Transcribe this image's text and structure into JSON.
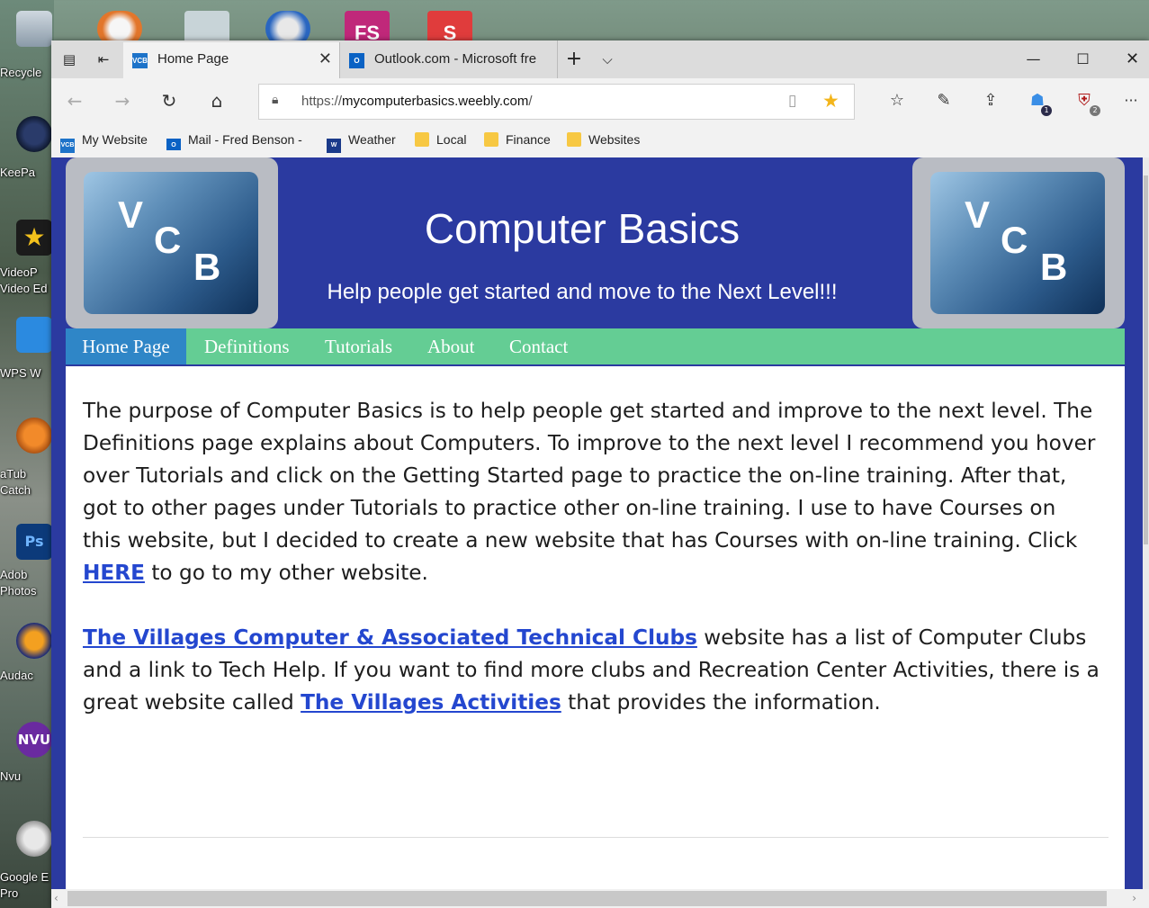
{
  "desktop": {
    "icons": [
      {
        "label": "Recycle"
      },
      {
        "label": "KeePa"
      },
      {
        "label": "VideoP\nVideo Ed"
      },
      {
        "label": "WPS W"
      },
      {
        "label": "aTub\nCatch"
      },
      {
        "label": "Adob\nPhotos"
      },
      {
        "label": "Audac"
      },
      {
        "label": "Nvu"
      },
      {
        "label": "Google E\nPro"
      }
    ],
    "top_apps": [
      {
        "text": ""
      },
      {
        "text": ""
      },
      {
        "text": ""
      },
      {
        "text": "FS"
      },
      {
        "text": "S"
      }
    ]
  },
  "browser": {
    "tabs": [
      {
        "title": "Home Page",
        "favicon": "VCB",
        "active": true
      },
      {
        "title": "Outlook.com - Microsoft fre",
        "favicon": "O",
        "active": false
      }
    ],
    "new_tab": "+",
    "tab_list": "⌵",
    "window_controls": {
      "minimize": "—",
      "maximize": "☐",
      "close": "✕"
    },
    "address": {
      "scheme": "https://",
      "host": "mycomputerbasics.weebly.com",
      "path": "/"
    },
    "extensions": [
      {
        "name": "ghostery-icon",
        "badge": "1"
      },
      {
        "name": "ublock-icon",
        "badge": "2"
      }
    ],
    "favorites": [
      {
        "label": "My Website",
        "icon": "VCB"
      },
      {
        "label": "Mail - Fred Benson - ",
        "icon": "O"
      },
      {
        "label": "Weather",
        "icon": "W"
      },
      {
        "label": "Local",
        "icon": "folder"
      },
      {
        "label": "Finance",
        "icon": "folder"
      },
      {
        "label": "Websites",
        "icon": "folder"
      }
    ]
  },
  "site": {
    "logo_letters": {
      "v": "V",
      "c": "C",
      "b": "B"
    },
    "title": "Computer Basics",
    "subtitle": "Help people get started and move to the Next Level!!!",
    "menu": [
      {
        "label": "Home Page",
        "active": true
      },
      {
        "label": "Definitions",
        "active": false
      },
      {
        "label": "Tutorials",
        "active": false
      },
      {
        "label": "About",
        "active": false
      },
      {
        "label": "Contact",
        "active": false
      }
    ],
    "para1": {
      "before": "The purpose of Computer Basics is to help people get started and improve to the next level.  The Definitions page explains about Computers.  To improve to the next level I recommend you hover over Tutorials and click on the Getting Started page to practice the on-line training.  After that, got to other pages under Tutorials to practice other on-line training.  I use to have Courses on this website, but I decided to create a new website that has Courses with on-line training.  Click ",
      "link": "HERE",
      "after": " to go to my other website."
    },
    "para2": {
      "link1": "The Villages Computer & Associated Technical Clubs",
      "middle": " website has a list of Computer Clubs and a link to Tech Help.  If you want to find more clubs and Recreation Center Activities, there is a great website called ",
      "link2": "The Villages Activities",
      "after": " that provides the information."
    }
  },
  "colors": {
    "site_blue": "#2b3aa0",
    "menu_green": "#64cd94",
    "menu_active": "#2f86c7",
    "link": "#2447cf",
    "favorite_star": "#f3b51b"
  }
}
